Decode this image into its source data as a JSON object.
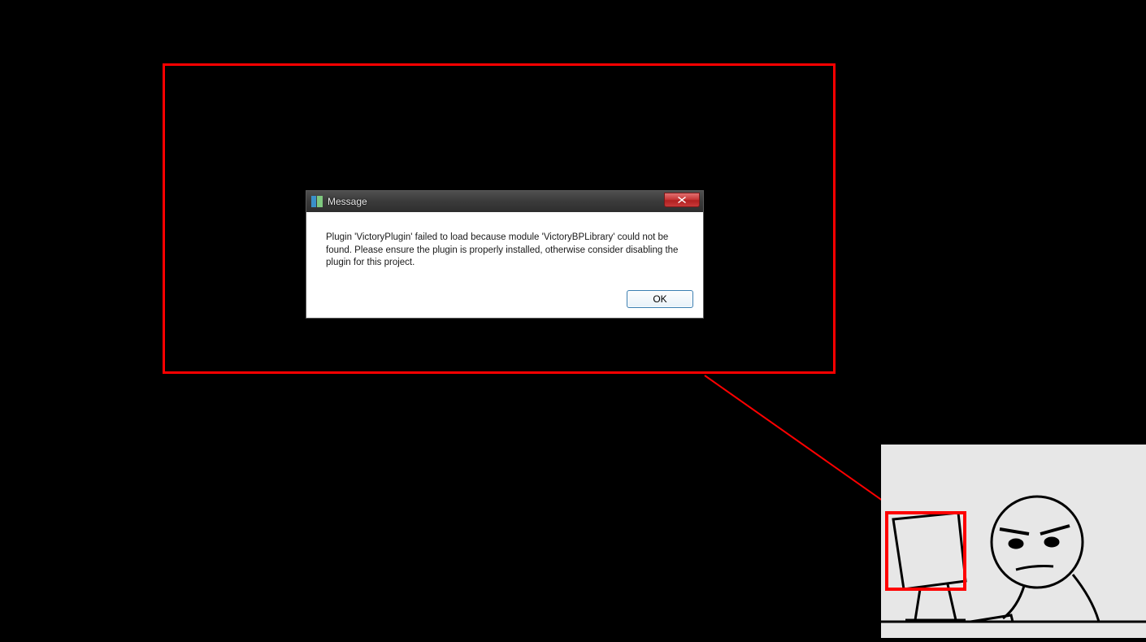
{
  "annotation": {
    "zoom_box_border": "#ff0000",
    "connector_color": "#ff0000"
  },
  "dialog": {
    "title": "Message",
    "body": "Plugin 'VictoryPlugin' failed to load because module 'VictoryBPLibrary' could not be found.  Please ensure the plugin is properly installed, otherwise consider disabling the plugin for this project.",
    "ok_label": "OK",
    "close_tooltip": "Close"
  },
  "meme": {
    "description": "computer-guy-stare-meme"
  }
}
